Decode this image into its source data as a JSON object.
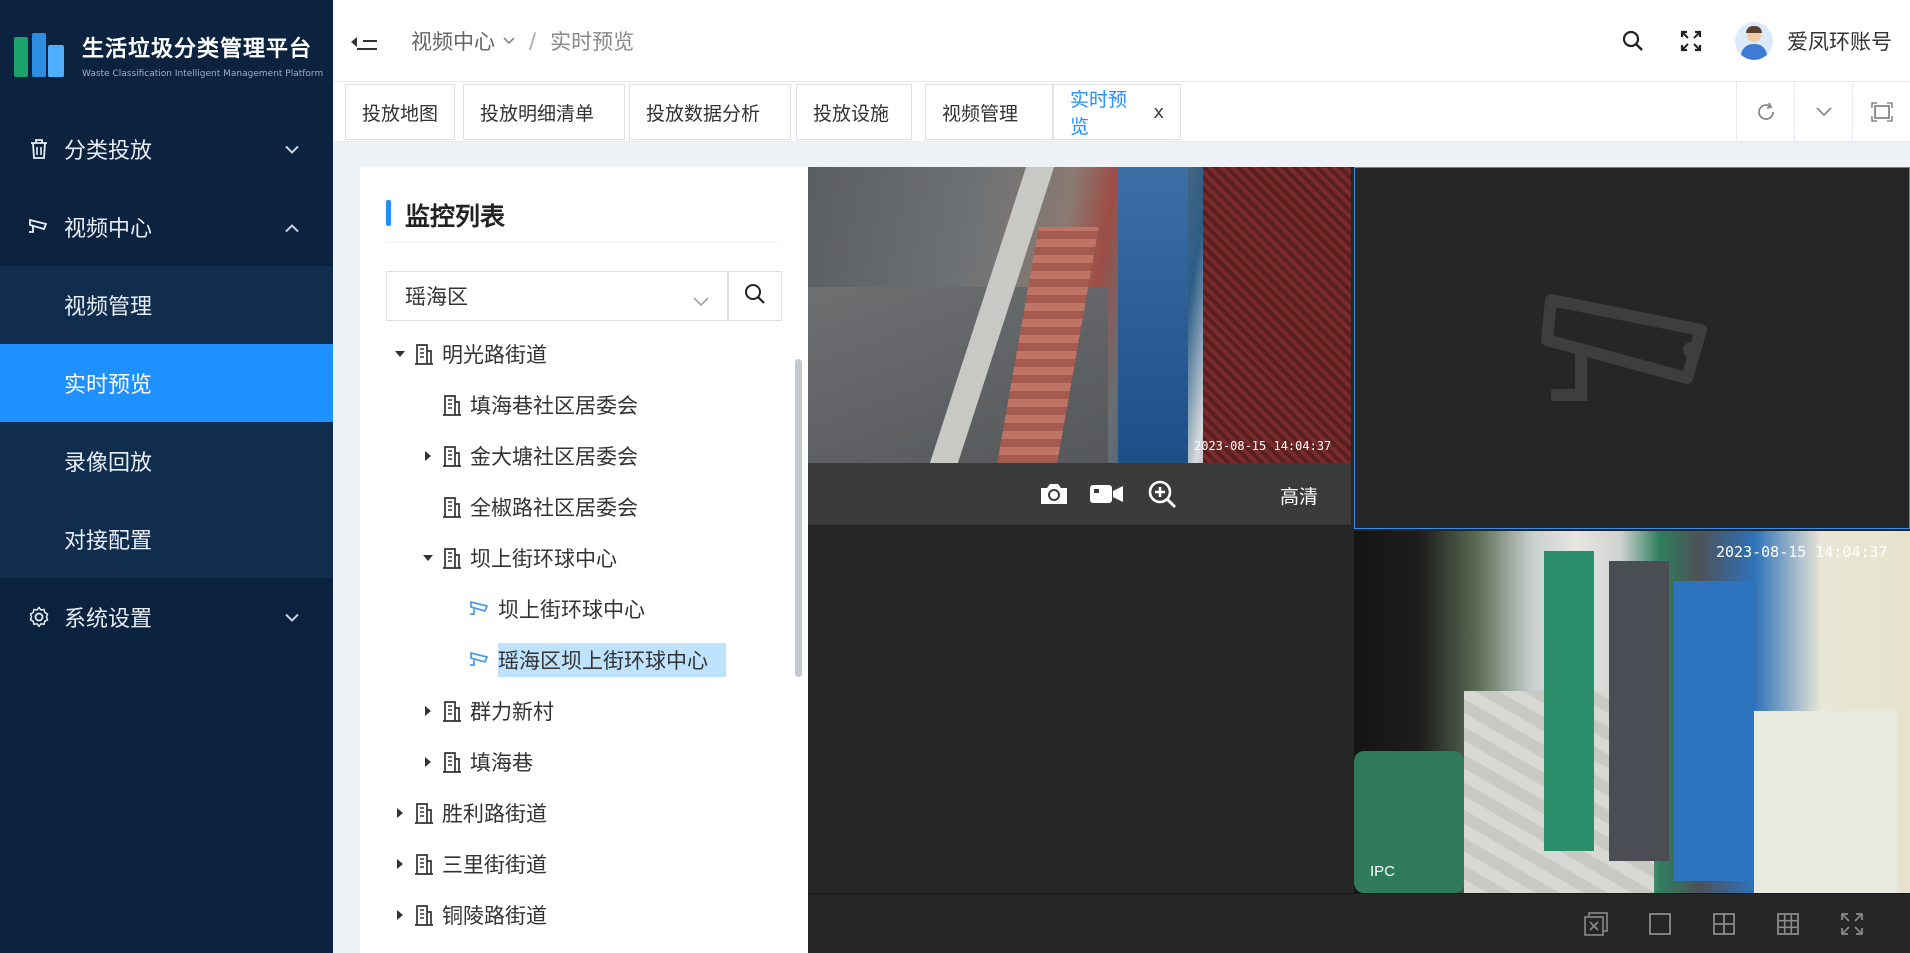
{
  "app": {
    "title": "生活垃圾分类管理平台",
    "subtitle": "Waste Classification Intelligent Management Platform"
  },
  "sidebar": {
    "items": [
      {
        "label": "分类投放",
        "icon": "trash-icon",
        "expanded": false
      },
      {
        "label": "视频中心",
        "icon": "camera-icon",
        "expanded": true
      },
      {
        "label": "系统设置",
        "icon": "gear-icon",
        "expanded": false
      }
    ],
    "video_sub": [
      {
        "label": "视频管理",
        "active": false
      },
      {
        "label": "实时预览",
        "active": true
      },
      {
        "label": "录像回放",
        "active": false
      },
      {
        "label": "对接配置",
        "active": false
      }
    ],
    "active_color": "#1e90ff",
    "bg_color": "#0c2340"
  },
  "header": {
    "breadcrumb": [
      "视频中心",
      "实时预览"
    ],
    "username": "爱凤环账号"
  },
  "tabs": [
    {
      "label": "投放地图"
    },
    {
      "label": "投放明细清单"
    },
    {
      "label": "投放数据分析"
    },
    {
      "label": "投放设施"
    },
    {
      "label": "视频管理"
    },
    {
      "label": "实时预览",
      "active": true,
      "close": "x"
    }
  ],
  "panel": {
    "title": "监控列表",
    "select_value": "瑶海区"
  },
  "tree": [
    {
      "label": "明光路街道",
      "level": 0,
      "caret": "expanded",
      "icon": "building-icon"
    },
    {
      "label": "填海巷社区居委会",
      "level": 1,
      "caret": "none",
      "icon": "building-icon"
    },
    {
      "label": "金大塘社区居委会",
      "level": 1,
      "caret": "collapsed",
      "icon": "building-icon"
    },
    {
      "label": "全椒路社区居委会",
      "level": 1,
      "caret": "none",
      "icon": "building-icon"
    },
    {
      "label": "坝上街环球中心",
      "level": 1,
      "caret": "expanded",
      "icon": "building-icon"
    },
    {
      "label": "坝上街环球中心",
      "level": 2,
      "caret": "none",
      "icon": "camera-icon"
    },
    {
      "label": "瑶海区坝上街环球中心",
      "level": 2,
      "caret": "none",
      "icon": "camera-icon",
      "selected": true
    },
    {
      "label": "群力新村",
      "level": 1,
      "caret": "collapsed",
      "icon": "building-icon"
    },
    {
      "label": "填海巷",
      "level": 1,
      "caret": "collapsed",
      "icon": "building-icon"
    },
    {
      "label": "胜利路街道",
      "level": 0,
      "caret": "collapsed",
      "icon": "building-icon"
    },
    {
      "label": "三里街街道",
      "level": 0,
      "caret": "collapsed",
      "icon": "building-icon"
    },
    {
      "label": "铜陵路街道",
      "level": 0,
      "caret": "collapsed",
      "icon": "building-icon"
    }
  ],
  "video": {
    "cam1_timestamp": "2023-08-15 14:04:37",
    "quality_label": "高清",
    "cam4_timestamp": "2023-08-15 14:04:37",
    "cam4_label": "IPC",
    "layout_buttons": [
      "close-all-icon",
      "layout-1-icon",
      "layout-4-icon",
      "layout-9-icon",
      "fullscreen-icon"
    ]
  }
}
